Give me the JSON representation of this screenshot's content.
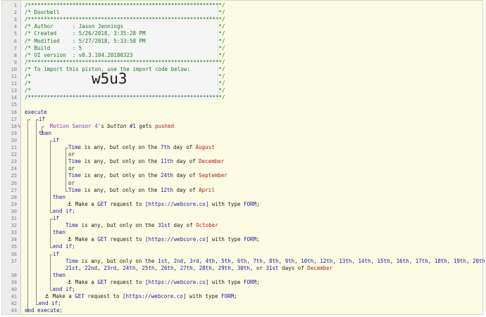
{
  "header_comments": [
    "/*************************************************************/",
    "/* Doorbell                                                  */",
    "/*************************************************************/",
    "/* Author      : Jason Jennings                              */",
    "/* Created     : 5/26/2018, 3:35:28 PM                       */",
    "/* Modified    : 5/27/2018, 5:33:58 PM                       */",
    "/* Build       : 5                                           */",
    "/* UI version  : v0.3.104.20180323                           */",
    "/*************************************************************/",
    "/* To import this piston, use the import code below:         */",
    "/*                                                           */",
    "/*                                                           */",
    "/*                                                           */",
    "/*************************************************************/"
  ],
  "import_code": "w5u3",
  "line_numbers": [
    "1",
    "2",
    "3",
    "4",
    "5",
    "6",
    "7",
    "8",
    "9",
    "10",
    "11",
    "12",
    "13",
    "14",
    "15",
    "16",
    "17",
    "18",
    "19",
    "20",
    "21",
    "22",
    "23",
    "24",
    "25",
    "26",
    "27",
    "28",
    "29",
    "30",
    "31",
    "32",
    "33",
    "34",
    "35",
    "36",
    "37",
    "38",
    "39",
    "40",
    "41",
    "42",
    "43"
  ],
  "keywords": {
    "execute": "execute",
    "if": "if",
    "then": "then",
    "or": "or",
    "end_if": "end if;",
    "end_execute": "end execute;"
  },
  "trigger": {
    "device": "Motion Sensor 4",
    "possessive": "'s",
    "attribute": "button",
    "button_no": "#1",
    "gets": "gets",
    "value": "pushed"
  },
  "conditions_group1": [
    {
      "subject": "Time",
      "text": " is any, but only on the ",
      "day": "7th",
      "mid": " day of ",
      "month": "August"
    },
    {
      "subject": "Time",
      "text": " is any, but only on the ",
      "day": "11th",
      "mid": " day of ",
      "month": "December"
    },
    {
      "subject": "Time",
      "text": " is any, but only on the ",
      "day": "24th",
      "mid": " day of ",
      "month": "September"
    },
    {
      "subject": "Time",
      "text": " is any, but only on the ",
      "day": "12th",
      "mid": " day of ",
      "month": "April"
    }
  ],
  "condition_group2": {
    "subject": "Time",
    "text": " is any, but only on the ",
    "day": "31st",
    "mid": " day of ",
    "month": "October"
  },
  "condition_group3": {
    "subject": "Time",
    "text": " is any, but only on the ",
    "days_line1": [
      "1st",
      "2nd",
      "3rd",
      "4th",
      "5th",
      "6th",
      "7th",
      "8th",
      "9th",
      "10th",
      "12th",
      "13th",
      "14th",
      "15th",
      "16th",
      "17th",
      "18th",
      "19th",
      "20th"
    ],
    "days_line2": [
      "21st",
      "22nd",
      "23rd",
      "24th",
      "25th",
      "26th",
      "27th",
      "28th",
      "29th",
      "30th"
    ],
    "or_word": "or",
    "last_day": "31st",
    "mid": " days of ",
    "month": "December"
  },
  "action": {
    "prefix": "Make a ",
    "method": "GET",
    "middle": " request to ",
    "url": "[https://webcore.co]",
    "type_text": " with type ",
    "type": "FORM",
    "suffix": ";"
  },
  "colors": {
    "comment": "#1d7a1d",
    "keyword": "#1a1aa6",
    "device": "#8f2fd1",
    "value": "#b51c1c",
    "background": "#fbfbe3"
  },
  "icons": {
    "task": "anchor-icon",
    "trigger": "lightning-icon"
  }
}
